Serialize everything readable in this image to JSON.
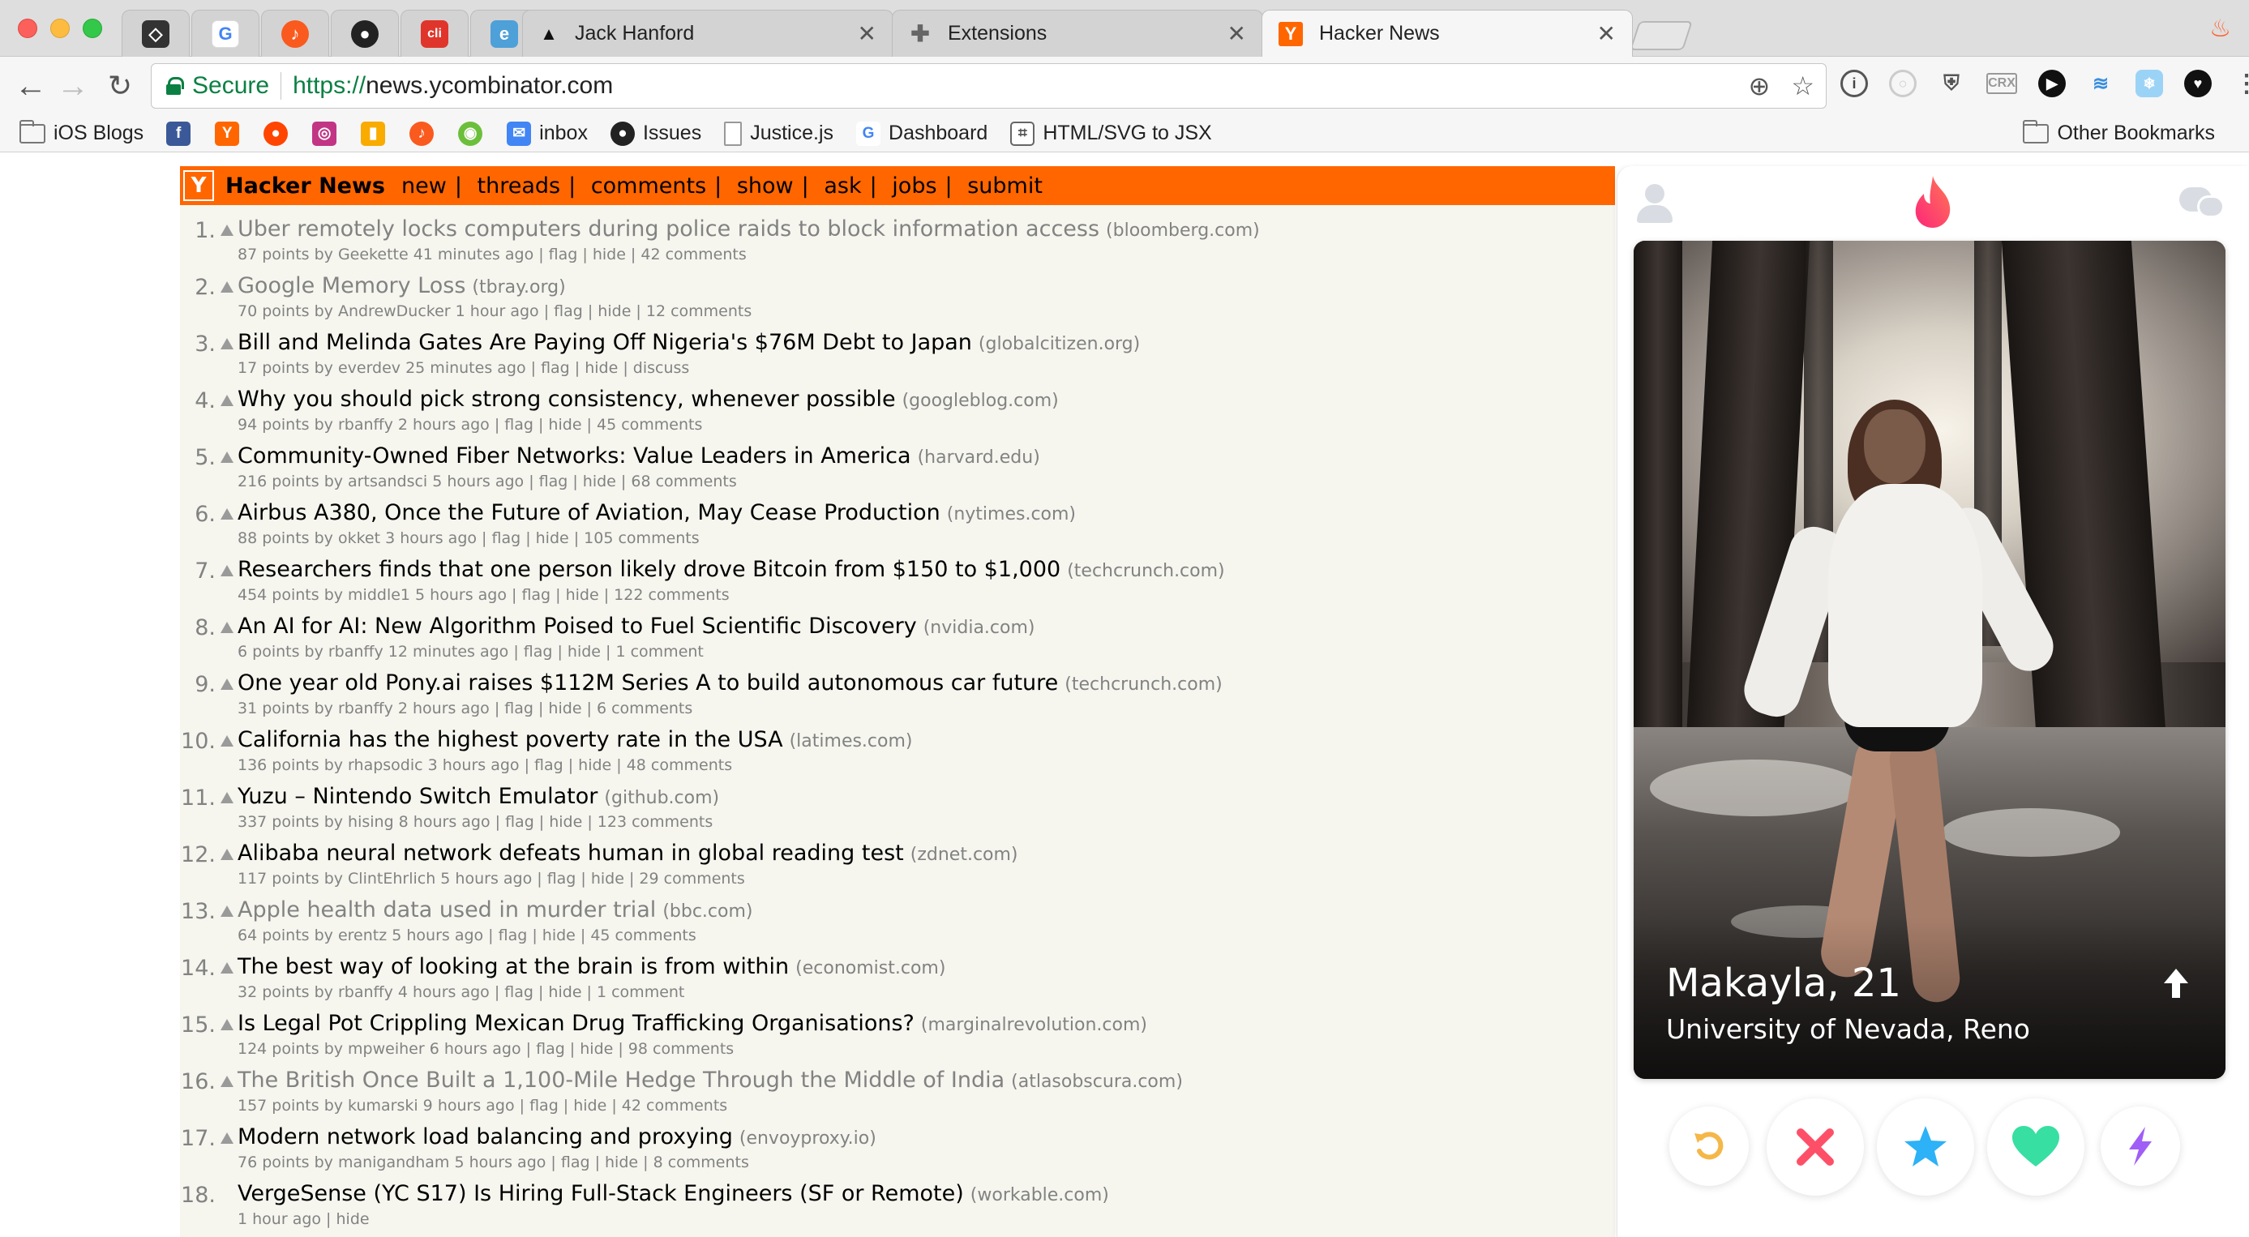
{
  "browser": {
    "tabs": [
      {
        "label": "Jack Hanford",
        "icon": "ink-triangle-icon"
      },
      {
        "label": "Extensions",
        "icon": "puzzle-piece-icon"
      },
      {
        "label": "Hacker News",
        "icon": "hn-y-icon",
        "active": true
      }
    ],
    "pinned_tabs": [
      "sketch-icon",
      "google-icon",
      "music-icon",
      "github-icon",
      "cli-icon",
      "editor-icon"
    ],
    "omnibox": {
      "secure_label": "Secure",
      "url_scheme": "https://",
      "url_rest": "news.ycombinator.com"
    },
    "bookmarks": [
      {
        "label": "iOS Blogs",
        "icon": "folder-icon"
      },
      {
        "label": "",
        "icon": "facebook-icon"
      },
      {
        "label": "",
        "icon": "hn-y-icon"
      },
      {
        "label": "",
        "icon": "reddit-icon"
      },
      {
        "label": "",
        "icon": "instagram-icon"
      },
      {
        "label": "",
        "icon": "analytics-icon"
      },
      {
        "label": "",
        "icon": "music-icon"
      },
      {
        "label": "",
        "icon": "circle-icon"
      },
      {
        "label": "inbox",
        "icon": "inbox-icon"
      },
      {
        "label": "Issues",
        "icon": "github-icon"
      },
      {
        "label": "Justice.js",
        "icon": "file-icon"
      },
      {
        "label": "Dashboard",
        "icon": "google-icon"
      },
      {
        "label": "HTML/SVG to JSX",
        "icon": "puzzle-icon"
      }
    ],
    "other_bookmarks": "Other Bookmarks"
  },
  "hn": {
    "logo": "Y",
    "title": "Hacker News",
    "nav": [
      "new",
      "threads",
      "comments",
      "show",
      "ask",
      "jobs",
      "submit"
    ],
    "stories": [
      {
        "rank": "1.",
        "title": "Uber remotely locks computers during police raids to block information access",
        "site": "(bloomberg.com)",
        "sub": "87 points by Geekette 41 minutes ago | flag | hide | 42 comments",
        "visited": true
      },
      {
        "rank": "2.",
        "title": "Google Memory Loss",
        "site": "(tbray.org)",
        "sub": "70 points by AndrewDucker 1 hour ago | flag | hide | 12 comments",
        "visited": true
      },
      {
        "rank": "3.",
        "title": "Bill and Melinda Gates Are Paying Off Nigeria's $76M Debt to Japan",
        "site": "(globalcitizen.org)",
        "sub": "17 points by everdev 25 minutes ago | flag | hide | discuss",
        "visited": false
      },
      {
        "rank": "4.",
        "title": "Why you should pick strong consistency, whenever possible",
        "site": "(googleblog.com)",
        "sub": "94 points by rbanffy 2 hours ago | flag | hide | 45 comments",
        "visited": false
      },
      {
        "rank": "5.",
        "title": "Community-Owned Fiber Networks: Value Leaders in America",
        "site": "(harvard.edu)",
        "sub": "216 points by artsandsci 5 hours ago | flag | hide | 68 comments",
        "visited": false
      },
      {
        "rank": "6.",
        "title": "Airbus A380, Once the Future of Aviation, May Cease Production",
        "site": "(nytimes.com)",
        "sub": "88 points by okket 3 hours ago | flag | hide | 105 comments",
        "visited": false
      },
      {
        "rank": "7.",
        "title": "Researchers finds that one person likely drove Bitcoin from $150 to $1,000",
        "site": "(techcrunch.com)",
        "sub": "454 points by middle1 5 hours ago | flag | hide | 122 comments",
        "visited": false
      },
      {
        "rank": "8.",
        "title": "An AI for AI: New Algorithm Poised to Fuel Scientific Discovery",
        "site": "(nvidia.com)",
        "sub": "6 points by rbanffy 12 minutes ago | flag | hide | 1 comment",
        "visited": false
      },
      {
        "rank": "9.",
        "title": "One year old Pony.ai raises $112M Series A to build autonomous car future",
        "site": "(techcrunch.com)",
        "sub": "31 points by rbanffy 2 hours ago | flag | hide | 6 comments",
        "visited": false
      },
      {
        "rank": "10.",
        "title": "California has the highest poverty rate in the USA",
        "site": "(latimes.com)",
        "sub": "136 points by rhapsodic 3 hours ago | flag | hide | 48 comments",
        "visited": false
      },
      {
        "rank": "11.",
        "title": "Yuzu – Nintendo Switch Emulator",
        "site": "(github.com)",
        "sub": "337 points by hising 8 hours ago | flag | hide | 123 comments",
        "visited": false
      },
      {
        "rank": "12.",
        "title": "Alibaba neural network defeats human in global reading test",
        "site": "(zdnet.com)",
        "sub": "117 points by ClintEhrlich 5 hours ago | flag | hide | 29 comments",
        "visited": false
      },
      {
        "rank": "13.",
        "title": "Apple health data used in murder trial",
        "site": "(bbc.com)",
        "sub": "64 points by erentz 5 hours ago | flag | hide | 45 comments",
        "visited": true
      },
      {
        "rank": "14.",
        "title": "The best way of looking at the brain is from within",
        "site": "(economist.com)",
        "sub": "32 points by rbanffy 4 hours ago | flag | hide | 1 comment",
        "visited": false
      },
      {
        "rank": "15.",
        "title": "Is Legal Pot Crippling Mexican Drug Trafficking Organisations?",
        "site": "(marginalrevolution.com)",
        "sub": "124 points by mpweiher 6 hours ago | flag | hide | 98 comments",
        "visited": false
      },
      {
        "rank": "16.",
        "title": "The British Once Built a 1,100-Mile Hedge Through the Middle of India",
        "site": "(atlasobscura.com)",
        "sub": "157 points by kumarski 9 hours ago | flag | hide | 42 comments",
        "visited": true
      },
      {
        "rank": "17.",
        "title": "Modern network load balancing and proxying",
        "site": "(envoyproxy.io)",
        "sub": "76 points by manigandham 5 hours ago | flag | hide | 8 comments",
        "visited": false
      },
      {
        "rank": "18.",
        "title": "VergeSense (YC S17) Is Hiring Full-Stack Engineers (SF or Remote)",
        "site": "(workable.com)",
        "sub": "1 hour ago | hide",
        "visited": false,
        "job": true
      }
    ]
  },
  "tinder": {
    "name": "Makayla, 21",
    "school": "University of Nevada, Reno",
    "actions": [
      "rewind-icon",
      "nope-icon",
      "super-like-icon",
      "like-icon",
      "boost-icon"
    ],
    "colors": {
      "flame": "#fd5068",
      "nope": "#fd5068",
      "star": "#2db1f7",
      "like": "#37dfa2",
      "rewind": "#f5b748",
      "boost": "#a05ef7"
    }
  }
}
